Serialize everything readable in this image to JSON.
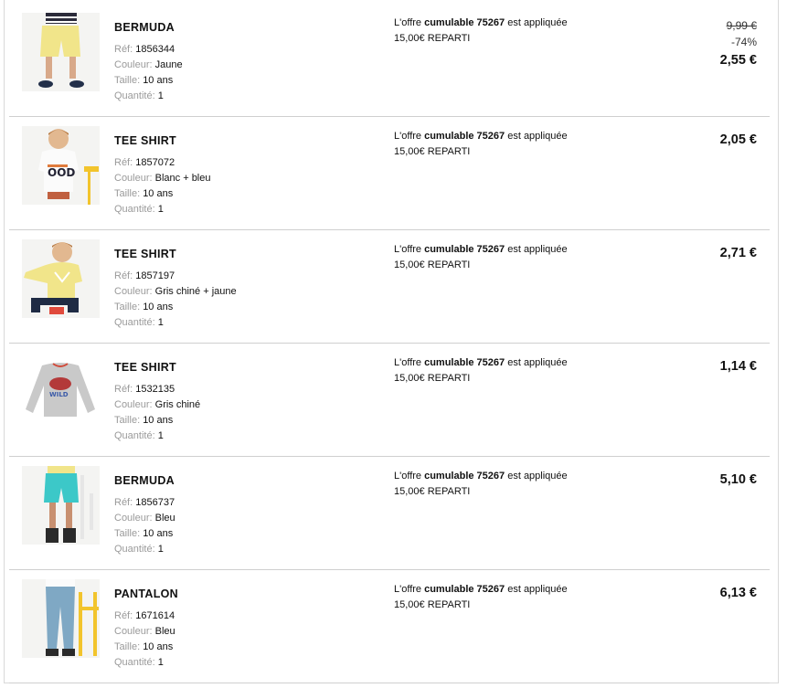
{
  "labels": {
    "ref": "Réf:",
    "couleur": "Couleur:",
    "taille": "Taille:",
    "quantite": "Quantité:"
  },
  "items": [
    {
      "name": "BERMUDA",
      "ref": "1856344",
      "couleur": "Jaune",
      "taille": "10 ans",
      "quantite": "1",
      "offer_prefix": "L'offre ",
      "offer_bold": "cumulable 75267",
      "offer_suffix": " est appliquée",
      "offer_line2": "15,00€ REPARTI",
      "old_price": "9,99 €",
      "discount": "-74%",
      "price": "2,55 €",
      "image_icon": "yellow-shorts-photo"
    },
    {
      "name": "TEE SHIRT",
      "ref": "1857072",
      "couleur": "Blanc + bleu",
      "taille": "10 ans",
      "quantite": "1",
      "offer_prefix": "L'offre ",
      "offer_bold": "cumulable 75267",
      "offer_suffix": " est appliquée",
      "offer_line2": "15,00€ REPARTI",
      "price": "2,05 €",
      "image_icon": "white-tshirt-photo"
    },
    {
      "name": "TEE SHIRT",
      "ref": "1857197",
      "couleur": "Gris chiné + jaune",
      "taille": "10 ans",
      "quantite": "1",
      "offer_prefix": "L'offre ",
      "offer_bold": "cumulable 75267",
      "offer_suffix": " est appliquée",
      "offer_line2": "15,00€ REPARTI",
      "price": "2,71 €",
      "image_icon": "yellow-tshirt-photo"
    },
    {
      "name": "TEE SHIRT",
      "ref": "1532135",
      "couleur": "Gris chiné",
      "taille": "10 ans",
      "quantite": "1",
      "offer_prefix": "L'offre ",
      "offer_bold": "cumulable 75267",
      "offer_suffix": " est appliquée",
      "offer_line2": "15,00€ REPARTI",
      "price": "1,14 €",
      "image_icon": "grey-longsleeve-photo"
    },
    {
      "name": "BERMUDA",
      "ref": "1856737",
      "couleur": "Bleu",
      "taille": "10 ans",
      "quantite": "1",
      "offer_prefix": "L'offre ",
      "offer_bold": "cumulable 75267",
      "offer_suffix": " est appliquée",
      "offer_line2": "15,00€ REPARTI",
      "price": "5,10 €",
      "image_icon": "blue-shorts-photo"
    },
    {
      "name": "PANTALON",
      "ref": "1671614",
      "couleur": "Bleu",
      "taille": "10 ans",
      "quantite": "1",
      "offer_prefix": "L'offre ",
      "offer_bold": "cumulable 75267",
      "offer_suffix": " est appliquée",
      "offer_line2": "15,00€ REPARTI",
      "price": "6,13 €",
      "image_icon": "blue-jeans-photo"
    }
  ],
  "colors": {
    "label_grey": "#9a9a9a",
    "divider": "#cfcfcf",
    "yellow": "#f1e58a",
    "turquoise": "#3cc8c8",
    "denim": "#7fa8c4",
    "heather_grey": "#c9c9c9"
  }
}
